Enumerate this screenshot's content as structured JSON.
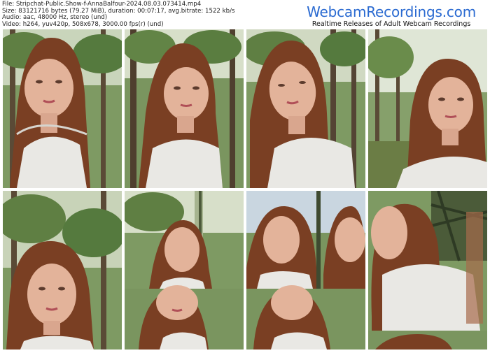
{
  "header": {
    "meta_lines": [
      "File: Stripchat-Public.Show-f-AnnaBalfour-2024.08.03.073414.mp4",
      "Size: 83121716 bytes (79.27 MiB), duration: 00:07:17, avg.bitrate: 1522 kb/s",
      "Audio: aac, 48000 Hz, stereo (und)",
      "Video: h264, yuv420p, 508x678, 3000.00 fps(r) (und)"
    ],
    "brand_title": "WebcamRecordings.com",
    "brand_subtitle": "Realtime Releases of Adult Webcam Recordings"
  },
  "thumbnails": [
    {
      "id": 1,
      "scene": "woman-selfie-forest"
    },
    {
      "id": 2,
      "scene": "woman-selfie-forest"
    },
    {
      "id": 3,
      "scene": "woman-selfie-forest"
    },
    {
      "id": 4,
      "scene": "woman-selfie-forest"
    },
    {
      "id": 5,
      "scene": "woman-selfie-forest"
    },
    {
      "id": 6,
      "scene": "woman-selfie-forest-glitched"
    },
    {
      "id": 7,
      "scene": "woman-selfie-forest-glitched"
    },
    {
      "id": 8,
      "scene": "woman-selfie-forest-glitched"
    }
  ],
  "colors": {
    "brand_blue": "#2a6ad1",
    "foliage": "#6f8a55",
    "hair": "#7a3f23",
    "skin": "#e3b39a",
    "jacket": "#e9e8e4"
  }
}
